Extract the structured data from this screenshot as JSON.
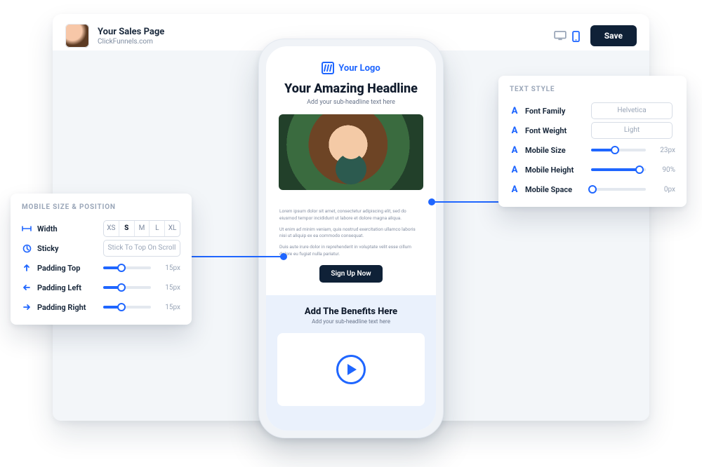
{
  "header": {
    "title": "Your Sales Page",
    "subtitle": "ClickFunnels.com",
    "save": "Save"
  },
  "phone": {
    "logo": "Your Logo",
    "headline": "Your Amazing Headline",
    "sub": "Add your sub-headline text here",
    "lorem": [
      "Lorem ipsum dolor sit amet, consectetur adipiscing elit, sed do eiusmod tempor incididunt ut labore et dolore magna aliqua.",
      "Ut enim ad minim veniam, quis nostrud exercitation ullamco laboris nisi ut aliquip ex ea commodo consequat.",
      "Duis aute irure dolor in reprehenderit in voluptate velit esse cillum dolore eu fugiat nulla pariatur."
    ],
    "cta": "Sign Up Now",
    "benefits_title": "Add The Benefits Here",
    "benefits_sub": "Add your sub-headline text here"
  },
  "left_panel": {
    "title": "MOBILE SIZE & POSITION",
    "width_label": "Width",
    "widths": [
      "XS",
      "S",
      "M",
      "L",
      "XL"
    ],
    "width_selected": "S",
    "sticky_label": "Sticky",
    "sticky_value": "Stick To Top On Scroll",
    "rows": [
      {
        "label": "Padding Top",
        "value": "15px",
        "pct": 38
      },
      {
        "label": "Padding Left",
        "value": "15px",
        "pct": 38
      },
      {
        "label": "Padding Right",
        "value": "15px",
        "pct": 38
      }
    ]
  },
  "right_panel": {
    "title": "TEXT STYLE",
    "font_family_label": "Font Family",
    "font_family_value": "Helvetica",
    "font_weight_label": "Font Weight",
    "font_weight_value": "Light",
    "rows": [
      {
        "label": "Mobile Size",
        "value": "23px",
        "pct": 44
      },
      {
        "label": "Mobile Height",
        "value": "90%",
        "pct": 88
      },
      {
        "label": "Mobile Space",
        "value": "0px",
        "pct": 2
      }
    ]
  }
}
